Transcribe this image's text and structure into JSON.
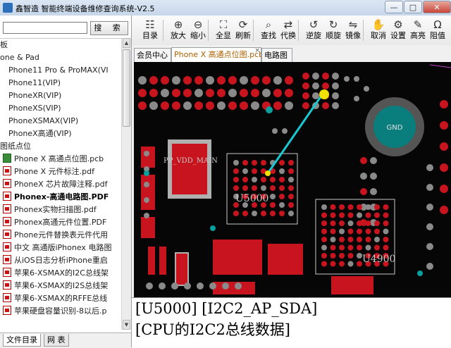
{
  "window": {
    "title": "鑫智造 智能终端设备维修查询系统-V2.5",
    "min_label": "—",
    "max_label": "□",
    "close_label": "✕"
  },
  "search": {
    "value": "",
    "button_label": "搜 索"
  },
  "tree": {
    "items": [
      {
        "label": "板",
        "icon": ""
      },
      {
        "label": "one & Pad",
        "icon": ""
      },
      {
        "label": "Phone11 Pro & ProMAX(VI",
        "icon": ""
      },
      {
        "label": "Phone11(VIP)",
        "icon": ""
      },
      {
        "label": "PhoneXR(VIP)",
        "icon": ""
      },
      {
        "label": "PhoneXS(VIP)",
        "icon": ""
      },
      {
        "label": "PhoneXSMAX(VIP)",
        "icon": ""
      },
      {
        "label": "PhoneX高通(VIP)",
        "icon": ""
      },
      {
        "label": "图纸点位",
        "icon": ""
      },
      {
        "label": "Phone X 高通点位图.pcb",
        "icon": "pcb-file-icon"
      },
      {
        "label": "Phone X 元件标注.pdf",
        "icon": "pdf-file-icon"
      },
      {
        "label": "PhoneX 芯片故障注释.pdf",
        "icon": "pdf-file-icon"
      },
      {
        "label": "Phonex-高通电路图.PDF",
        "icon": "pdf-file-icon"
      },
      {
        "label": "Phonex实物扫描图.pdf",
        "icon": "pdf-file-icon"
      },
      {
        "label": "Phonex高通元件位置.PDF",
        "icon": "pdf-file-icon"
      },
      {
        "label": "Phone元件替换表元件代用",
        "icon": "pdf-file-icon"
      },
      {
        "label": "中文 高通版iPhonex 电路图",
        "icon": "pdf-file-icon"
      },
      {
        "label": "从iOS日志分析iPhone重启",
        "icon": "pdf-file-icon"
      },
      {
        "label": "苹果6-XSMAX的I2C总线架",
        "icon": "pdf-file-icon"
      },
      {
        "label": "苹果6-XSMAX的I2S总线架",
        "icon": "pdf-file-icon"
      },
      {
        "label": "苹果6-XSMAX的RFFE总线",
        "icon": "pdf-file-icon"
      },
      {
        "label": "苹果硬盘容量识别-8以后.p",
        "icon": "pdf-file-icon"
      }
    ]
  },
  "bottom_tabs": [
    {
      "label": "文件目录"
    },
    {
      "label": "网 表"
    }
  ],
  "toolbar": {
    "items": [
      {
        "label": "目录",
        "icon": "directory-icon"
      },
      {
        "label": "放大",
        "icon": "zoom-in-icon"
      },
      {
        "label": "缩小",
        "icon": "zoom-out-icon"
      },
      {
        "label": "全显",
        "icon": "fit-all-icon"
      },
      {
        "label": "刷新",
        "icon": "refresh-icon"
      },
      {
        "label": "查找",
        "icon": "search-icon"
      },
      {
        "label": "代换",
        "icon": "replace-icon"
      },
      {
        "label": "逆旋",
        "icon": "rotate-ccw-icon"
      },
      {
        "label": "顺旋",
        "icon": "rotate-cw-icon"
      },
      {
        "label": "镜像",
        "icon": "mirror-icon"
      },
      {
        "label": "取消",
        "icon": "cancel-icon"
      },
      {
        "label": "设置",
        "icon": "settings-icon"
      },
      {
        "label": "高亮",
        "icon": "highlight-icon"
      },
      {
        "label": "阻值",
        "icon": "resistance-icon"
      }
    ]
  },
  "doc_tabs": [
    {
      "label": "会员中心",
      "active": false
    },
    {
      "label": "Phone X 高通点位图.pcb",
      "active": true,
      "close": "×"
    },
    {
      "label": "电路图",
      "active": false
    }
  ],
  "board": {
    "labels": {
      "gnd": "GND",
      "pp_vdd_main": "PP_VDD_MAIN",
      "u5000": "U5000",
      "u4900": "U4900"
    },
    "colors": {
      "pad_red": "#c8141e",
      "pad_gray": "#8a8a8a",
      "pad_cyan": "#0aa0a0",
      "trace": "#18c8d0",
      "pin_yellow": "#f0e000",
      "silk": "#c8c8c8"
    }
  },
  "status": {
    "line1": "[U5000] [I2C2_AP_SDA]",
    "line2": "[CPU的I2C2总线数据]"
  }
}
